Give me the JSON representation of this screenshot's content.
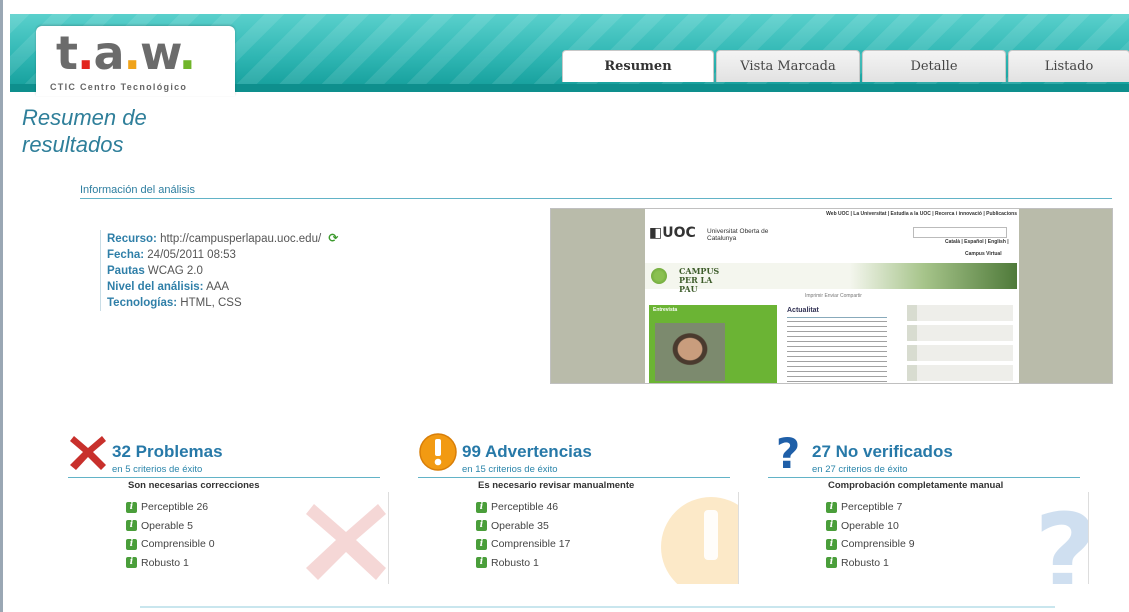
{
  "logo": {
    "mark_t": "t",
    "mark_a": "a",
    "mark_w": "w",
    "caption": "CTIC Centro Tecnológico"
  },
  "tabs": [
    {
      "label": "Resumen",
      "active": true
    },
    {
      "label": "Vista Marcada",
      "active": false
    },
    {
      "label": "Detalle",
      "active": false
    },
    {
      "label": "Listado",
      "active": false
    }
  ],
  "page_title": "Resumen de resultados",
  "section_label": "Información del análisis",
  "info": {
    "resource_label": "Recurso:",
    "resource_value": "http://campusperlapau.uoc.edu/",
    "date_label": "Fecha:",
    "date_value": "24/05/2011 08:53",
    "guidelines_label": "Pautas",
    "guidelines_value": "WCAG 2.0",
    "level_label": "Nivel del análisis:",
    "level_value": "AAA",
    "tech_label": "Tecnologías:",
    "tech_value": "HTML, CSS"
  },
  "thumbnail": {
    "topnav": "Web UOC | La Universitat | Estudia a la UOC | Recerca i innovació | Publicacions",
    "uoc": "UOC",
    "uoc_name": "Universitat Oberta de Catalunya",
    "lang": "Català | Español | English |",
    "virtual": "Campus Virtual",
    "campus": "CAMPUS PER LA PAU",
    "tools": "Imprimir   Enviar   Compartir",
    "news_title": "Actualitat",
    "green_title": "Entrevista"
  },
  "results": [
    {
      "icon": "error-x-icon",
      "count_label": "32 Problemas",
      "criteria": "en 5 criterios de éxito",
      "subtitle": "Son necesarias correcciones",
      "items": [
        "Perceptible 26",
        "Operable 5",
        "Comprensible 0",
        "Robusto 1"
      ],
      "color": "#c8302c"
    },
    {
      "icon": "warning-icon",
      "count_label": "99 Advertencias",
      "criteria": "en 15 criterios de éxito",
      "subtitle": "Es necesario revisar manualmente",
      "items": [
        "Perceptible 46",
        "Operable 35",
        "Comprensible 17",
        "Robusto 1"
      ],
      "color": "#f29a12"
    },
    {
      "icon": "question-icon",
      "count_label": "27 No verificados",
      "criteria": "en 27 criterios de éxito",
      "subtitle": "Comprobación completamente manual",
      "items": [
        "Perceptible 7",
        "Operable 10",
        "Comprensible 9",
        "Robusto 1"
      ],
      "color": "#1f5fa8"
    }
  ]
}
